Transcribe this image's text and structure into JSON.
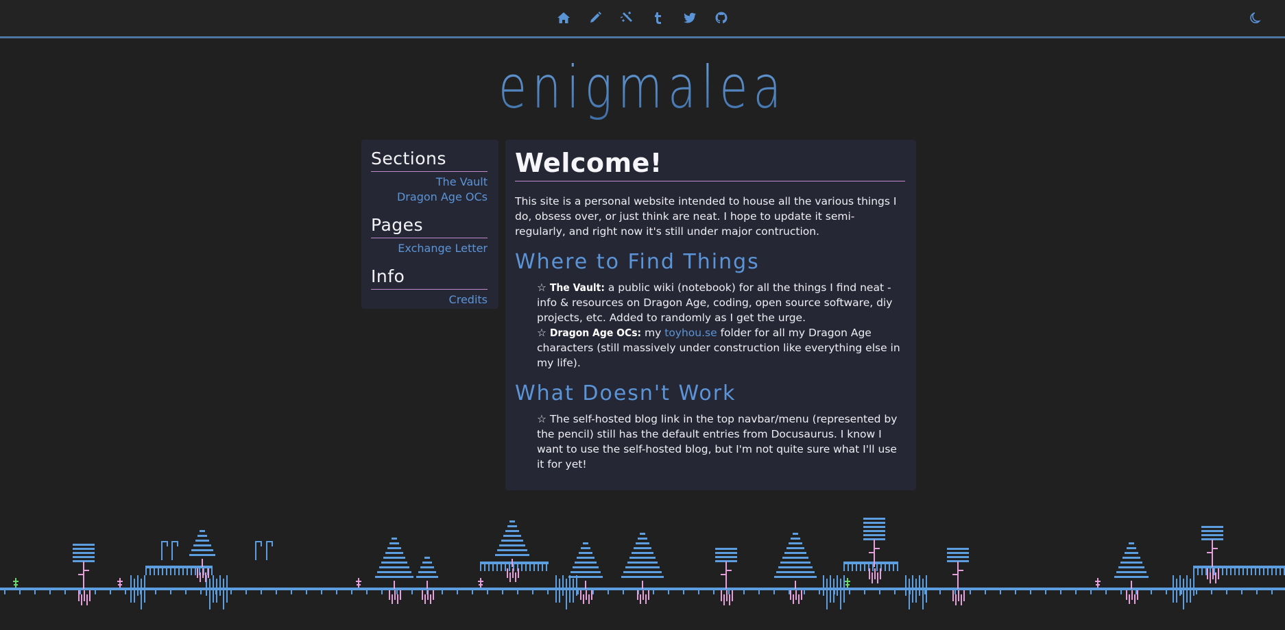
{
  "navbar": {
    "icons": [
      "home-icon",
      "pencil-icon",
      "broken-link-icon",
      "tumblr-icon",
      "twitter-icon",
      "github-icon"
    ],
    "theme_icon": "moon-icon",
    "accent_color": "#5a93d6"
  },
  "site": {
    "title": "enigmalea"
  },
  "sidebar": {
    "sections_heading": "Sections",
    "sections": [
      {
        "label": "The Vault"
      },
      {
        "label": "Dragon Age OCs"
      }
    ],
    "pages_heading": "Pages",
    "pages": [
      {
        "label": "Exchange Letter"
      }
    ],
    "info_heading": "Info",
    "info": [
      {
        "label": "Credits"
      }
    ]
  },
  "main": {
    "title": "Welcome!",
    "intro": "This site is a personal website intended to house all the various things I do, obsess over, or just think are neat. I hope to update it semi-regularly, and right now it's still under major contruction.",
    "find_heading": "Where to Find Things",
    "find_items": [
      {
        "star": "☆",
        "name": "The Vault:",
        "text": " a public wiki (notebook) for all the things I find neat - info & resources on Dragon Age, coding, open source software, diy projects, etc. Added to randomly as I get the urge."
      },
      {
        "star": "☆",
        "name": "Dragon Age OCs:",
        "text_before": " my ",
        "link": "toyhou.se",
        "text_after": " folder for all my Dragon Age characters (still massively under construction like everything else in my life)."
      }
    ],
    "broken_heading": "What Doesn't Work",
    "broken_items": [
      {
        "star": "☆",
        "text": "  The self-hosted blog link in the top navbar/menu (represented by the pencil) still has the default entries from Docusaurus. I know I want to use the self-hosted blog, but I'm not quite sure what I'll use it for yet!"
      }
    ]
  },
  "colors": {
    "background": "#202020",
    "card": "#262734",
    "link": "#5b95d8",
    "rule": "#c58ad0",
    "pixel_blue": "#5d9ee0",
    "pixel_pink": "#e5a0dc",
    "pixel_green": "#6bd66b"
  }
}
